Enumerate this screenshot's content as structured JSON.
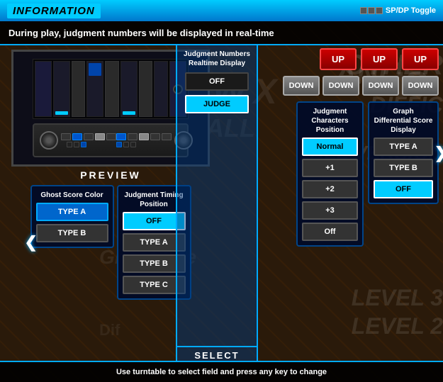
{
  "topBar": {
    "title": "INFORMATION",
    "spdpLabel": "SP/DP Toggle"
  },
  "infoBar": {
    "label": "",
    "text": "During play, judgment numbers will be displayed in real-time"
  },
  "preview": {
    "label": "PREVIEW"
  },
  "ghostScore": {
    "title": "Ghost Score Color",
    "typeA": "TYPE A",
    "typeB": "TYPE B"
  },
  "judgmentTiming": {
    "title": "Judgment Timing\nPosition",
    "off": "OFF",
    "typeA": "TYPE A",
    "typeB": "TYPE B",
    "typeC": "TYPE C"
  },
  "judgmentNumbers": {
    "title": "Judgment Numbers\nRealtime Display",
    "off": "OFF",
    "judge": "JUDGE",
    "selectLabel": "SELECT"
  },
  "judgmentChars": {
    "title": "Judgment Characters\nPosition",
    "normal": "Normal",
    "plus1": "+1",
    "plus2": "+2",
    "plus3": "+3",
    "off": "Off"
  },
  "graphDifferential": {
    "title": "Graph Differential\nScore Display",
    "typeA": "TYPE A",
    "typeB": "TYPE B",
    "off": "OFF"
  },
  "navButtons": {
    "up1": "UP",
    "up2": "UP",
    "up3": "UP",
    "down1": "DOWN",
    "down2": "DOWN",
    "down3": "DOWN",
    "down4": "DOWN"
  },
  "arrowLeft": "❮",
  "arrowRight": "❯",
  "bottomBar": {
    "text": "Use turntable to select field and press any key to change"
  },
  "bgText": {
    "other": "OTHER",
    "diff": "DIFFIC",
    "version": "ALL VERSION"
  }
}
